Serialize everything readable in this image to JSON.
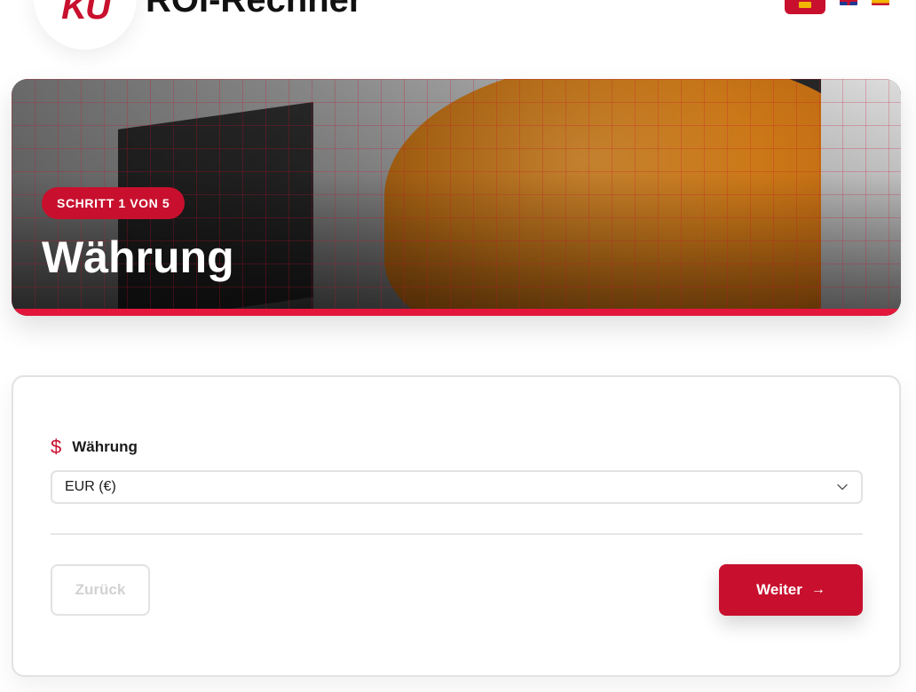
{
  "header": {
    "logo_text": "KU",
    "title": "ROI-Rechner"
  },
  "languages": {
    "active": "de-flag-icon",
    "others": [
      "uk-flag-icon",
      "es-flag-icon"
    ]
  },
  "hero": {
    "step_label": "SCHRITT 1 VON 5",
    "title": "Währung"
  },
  "form": {
    "field_label": "Währung",
    "field_icon": "dollar-icon",
    "currency_value": "EUR (€)"
  },
  "navigation": {
    "back_label": "Zurück",
    "next_label": "Weiter"
  },
  "colors": {
    "accent": "#c8102e",
    "hero_bar": "#e3173b",
    "border": "#e2e2e2",
    "disabled_text": "#d2d2d2"
  }
}
